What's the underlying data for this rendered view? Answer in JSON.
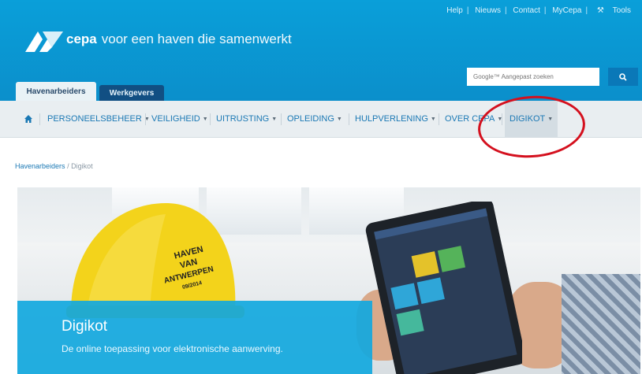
{
  "toplinks": [
    "Help",
    "Nieuws",
    "Contact",
    "MyCepa",
    "Tools"
  ],
  "brand": {
    "name": "cepa",
    "tagline": "voor een haven die samenwerkt"
  },
  "search": {
    "placeholder": "Google™ Aangepast zoeken"
  },
  "tabs": [
    "Havenarbeiders",
    "Werkgevers"
  ],
  "nav": {
    "items": [
      "PERSONEELSBEHEER",
      "VEILIGHEID",
      "UITRUSTING",
      "OPLEIDING",
      "HULPVERLENING",
      "OVER CEPA",
      "DIGIKOT"
    ],
    "active": "DIGIKOT"
  },
  "breadcrumb": {
    "home": "Havenarbeiders",
    "current": "Digikot"
  },
  "hero": {
    "title": "Digikot",
    "subtitle": "De online toepassing voor elektronische aanwerving.",
    "helmet_text": [
      "HAVEN",
      "VAN",
      "ANTWERPEN",
      "09/2014"
    ]
  },
  "colors": {
    "brand_blue": "#0a9fd9",
    "nav_link": "#1a78b4",
    "highlight": "#d4101e",
    "caption_bg": "#12a8de"
  }
}
